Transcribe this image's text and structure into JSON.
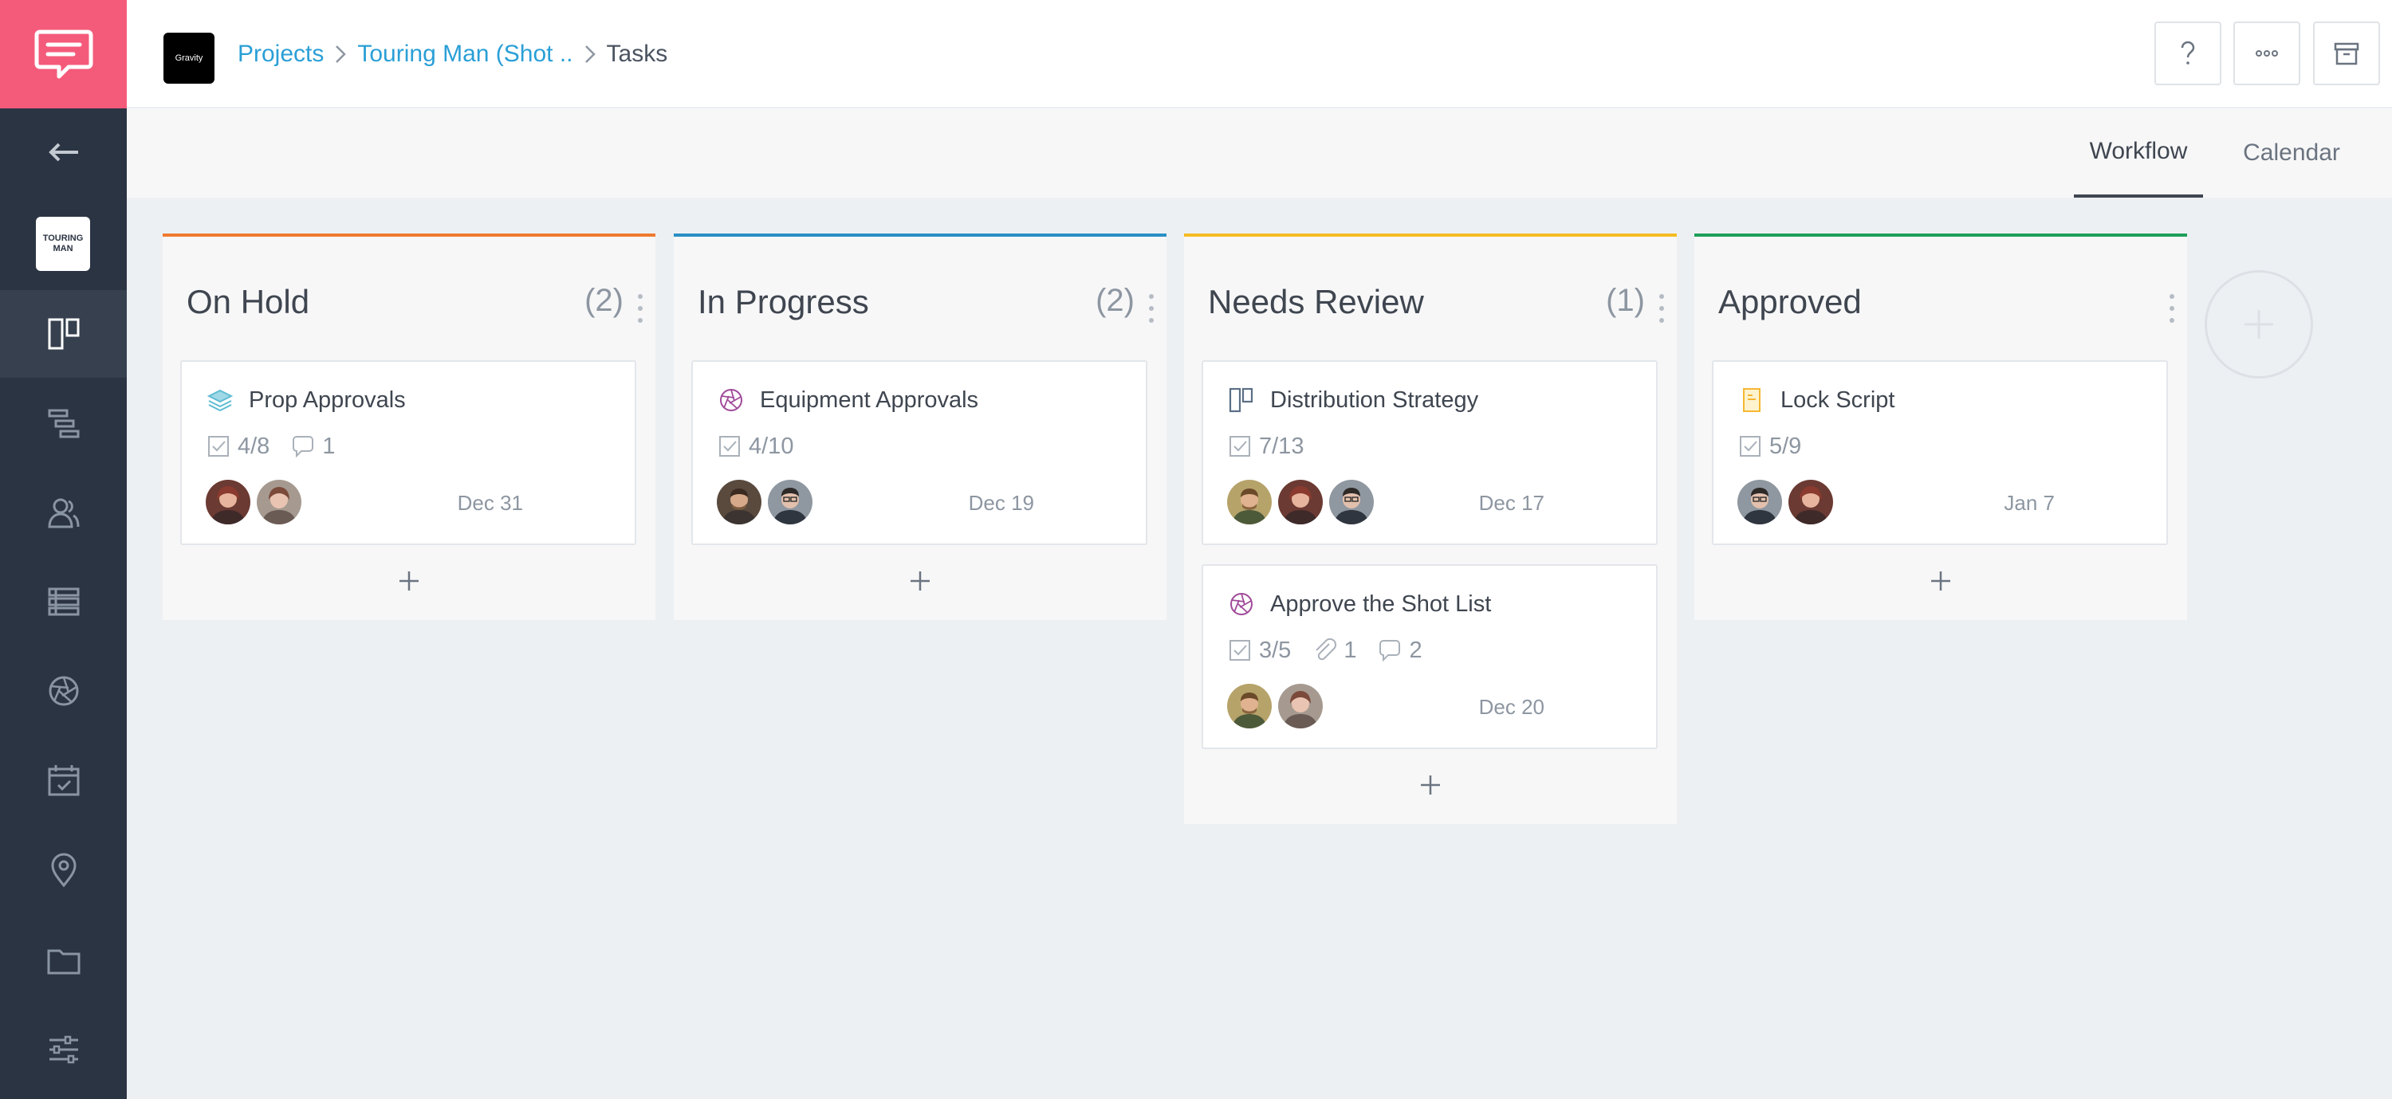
{
  "sidebar": {
    "project_thumb_line1": "TOURING",
    "project_thumb_line2": "MAN",
    "items": [
      {
        "name": "back",
        "icon": "arrow-left-icon"
      },
      {
        "name": "project",
        "icon": "project-thumbnail"
      },
      {
        "name": "board",
        "icon": "board-icon",
        "active": true
      },
      {
        "name": "timeline",
        "icon": "timeline-icon"
      },
      {
        "name": "contacts",
        "icon": "people-icon"
      },
      {
        "name": "stripboard",
        "icon": "list-icon"
      },
      {
        "name": "shots",
        "icon": "aperture-icon"
      },
      {
        "name": "calendar",
        "icon": "calendar-icon"
      },
      {
        "name": "locations",
        "icon": "location-pin-icon"
      },
      {
        "name": "files",
        "icon": "folder-icon"
      },
      {
        "name": "settings",
        "icon": "sliders-icon"
      }
    ]
  },
  "header": {
    "org_logo_text": "Gravity",
    "breadcrumb": {
      "projects": "Projects",
      "project": "Touring Man (Shot ..",
      "current": "Tasks"
    },
    "help_icon": "question-icon",
    "more_icon": "more-dots-icon",
    "archive_icon": "archive-icon"
  },
  "tabs": {
    "workflow": "Workflow",
    "calendar": "Calendar",
    "active": "workflow"
  },
  "columns": [
    {
      "title": "On Hold",
      "count": "(2)",
      "color": "#f07a30",
      "cards": [
        {
          "title": "Prop Approvals",
          "icon": "layers-icon",
          "checklist": "4/8",
          "comments": "1",
          "date": "Dec 31"
        }
      ]
    },
    {
      "title": "In Progress",
      "count": "(2)",
      "color": "#2a8fc4",
      "cards": [
        {
          "title": "Equipment Approvals",
          "icon": "aperture-icon",
          "checklist": "4/10",
          "date": "Dec 19"
        }
      ]
    },
    {
      "title": "Needs Review",
      "count": "(1)",
      "color": "#f5bc22",
      "cards": [
        {
          "title": "Distribution Strategy",
          "icon": "board-icon",
          "checklist": "7/13",
          "date": "Dec 17"
        },
        {
          "title": "Approve the Shot List",
          "icon": "aperture-icon",
          "checklist": "3/5",
          "attachments": "1",
          "comments": "2",
          "date": "Dec 20"
        }
      ]
    },
    {
      "title": "Approved",
      "count": "",
      "color": "#1f9f5a",
      "cards": [
        {
          "title": "Lock Script",
          "icon": "script-icon",
          "checklist": "5/9",
          "date": "Jan 7"
        }
      ]
    }
  ],
  "colors": {
    "brand": "#f45b7a",
    "sidebar": "#2b3443",
    "link": "#2a9fd6"
  }
}
